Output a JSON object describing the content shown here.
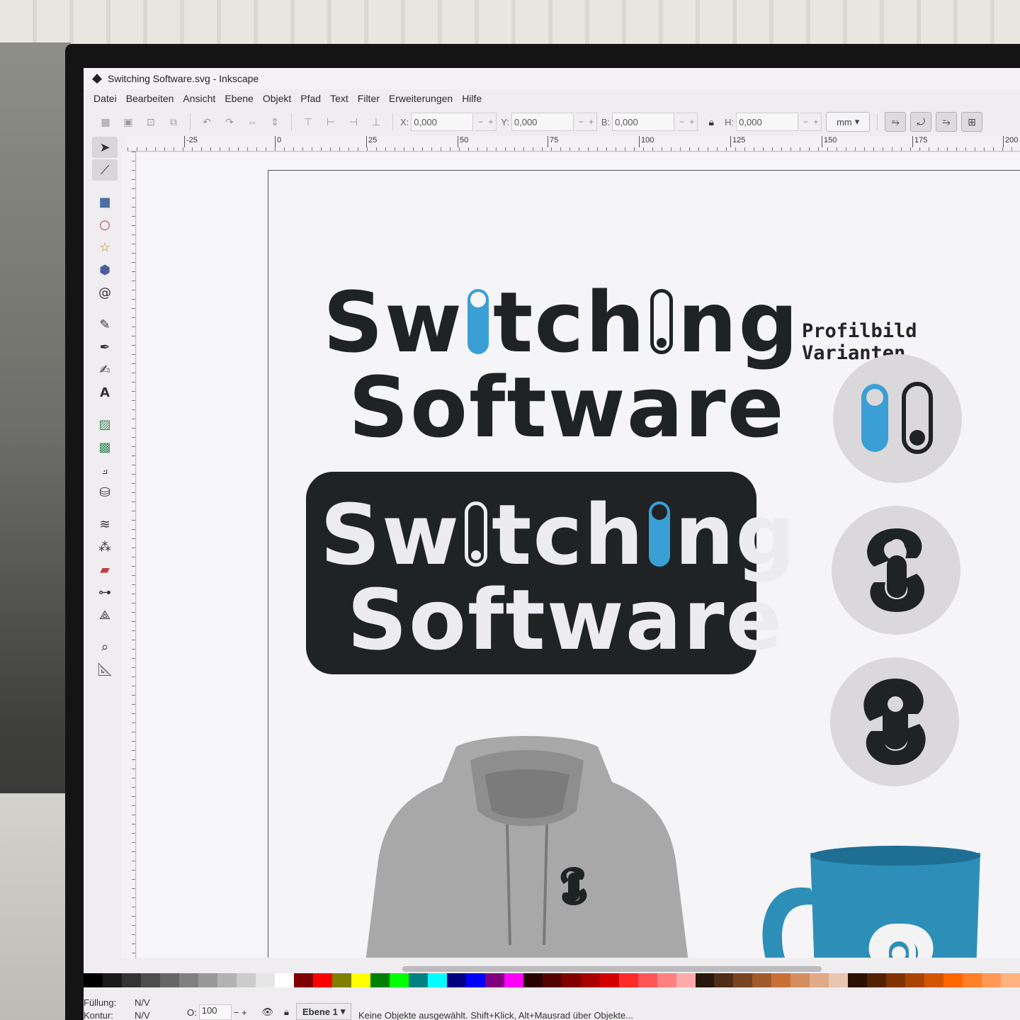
{
  "window": {
    "title": "Switching Software.svg - Inkscape"
  },
  "menu": [
    "Datei",
    "Bearbeiten",
    "Ansicht",
    "Ebene",
    "Objekt",
    "Pfad",
    "Text",
    "Filter",
    "Erweiterungen",
    "Hilfe"
  ],
  "toolbar": {
    "x_label": "X:",
    "x_value": "0,000",
    "y_label": "Y:",
    "y_value": "0,000",
    "w_label": "B:",
    "w_value": "0,000",
    "h_label": "H:",
    "h_value": "0,000",
    "unit": "mm"
  },
  "ruler": {
    "top_ticks": [
      "-25",
      "0",
      "25",
      "50",
      "75",
      "100",
      "125",
      "150",
      "175",
      "200"
    ]
  },
  "tools": [
    "selector-tool",
    "node-tool",
    "rect-tool",
    "circle-tool",
    "star-tool",
    "3dbox-tool",
    "spiral-tool",
    "pencil-tool",
    "pen-tool",
    "calligraphy-tool",
    "text-tool",
    "gradient-tool",
    "mesh-tool",
    "dropper-tool",
    "paintbucket-tool",
    "tweak-tool",
    "spray-tool",
    "eraser-tool",
    "connector-tool",
    "measure-tool",
    "zoom-tool",
    "ruler-tool"
  ],
  "canvas": {
    "logo_light": {
      "line1_a": "Sw",
      "line1_b": "tch",
      "line1_c": "ng",
      "line2": "Software"
    },
    "logo_dark": {
      "line1_a": "Sw",
      "line1_b": "tch",
      "line1_c": "ng",
      "line2": "Software"
    },
    "profile_title": "Profilbild Varianten"
  },
  "colors": {
    "accent_blue": "#3a9fd4",
    "dark": "#1f2323",
    "mug_blue": "#2d8fb8"
  },
  "statusbar": {
    "fill_label": "Füllung:",
    "fill_value": "N/V",
    "stroke_label": "Kontur:",
    "stroke_value": "N/V",
    "opacity_label": "O:",
    "opacity_value": "100",
    "layer": "Ebene 1",
    "message": "Keine Objekte ausgewählt. Shift+Klick, Alt+Mausrad über Objekte..."
  }
}
